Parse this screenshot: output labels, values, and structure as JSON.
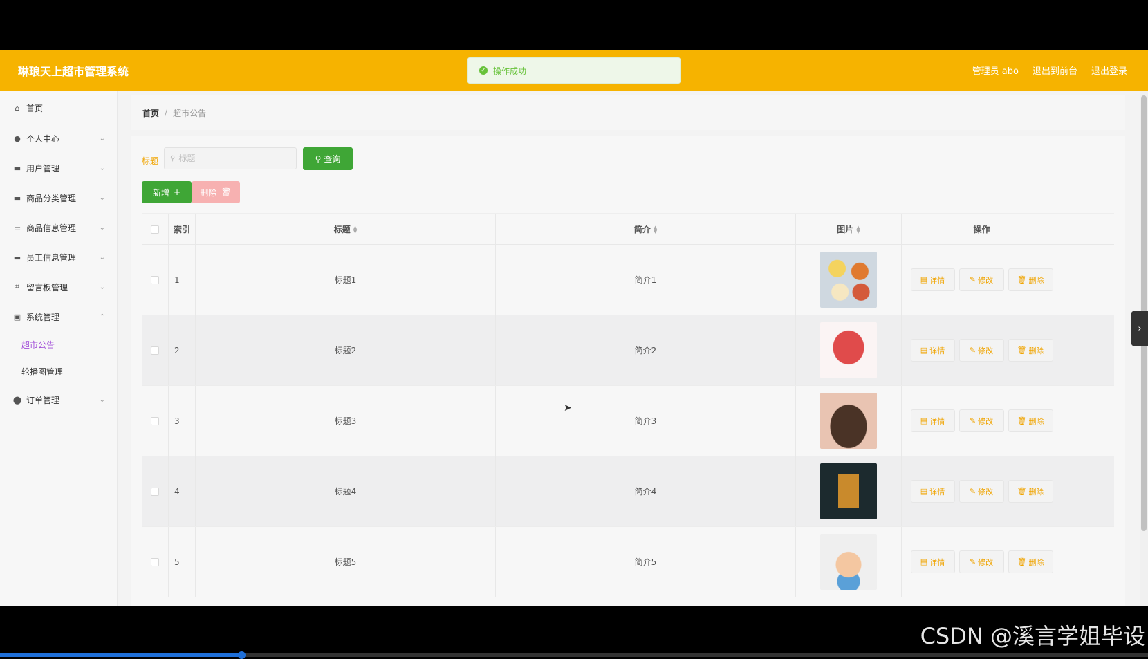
{
  "header": {
    "brand": "琳琅天上超市管理系统",
    "admin": "管理员 abo",
    "frontend_link": "退出到前台",
    "logout_link": "退出登录"
  },
  "toast": {
    "message": "操作成功"
  },
  "sidebar": {
    "items": [
      {
        "label": "首页",
        "icon": "home-icon"
      },
      {
        "label": "个人中心",
        "icon": "user-icon"
      },
      {
        "label": "用户管理",
        "icon": "briefcase-icon"
      },
      {
        "label": "商品分类管理",
        "icon": "monitor-icon"
      },
      {
        "label": "商品信息管理",
        "icon": "list-icon"
      },
      {
        "label": "员工信息管理",
        "icon": "monitor-icon"
      },
      {
        "label": "留言板管理",
        "icon": "crop-icon"
      },
      {
        "label": "系统管理",
        "icon": "clipboard-icon"
      },
      {
        "label": "订单管理",
        "icon": "location-icon"
      }
    ],
    "sub_items": [
      {
        "label": "超市公告",
        "active": true
      },
      {
        "label": "轮播图管理",
        "active": false
      }
    ]
  },
  "breadcrumb": {
    "home": "首页",
    "separator": "/",
    "current": "超市公告"
  },
  "search": {
    "label": "标题",
    "placeholder": "标题",
    "query_button": "查询"
  },
  "actions": {
    "add": "新增",
    "delete": "删除"
  },
  "table": {
    "columns": [
      "索引",
      "标题",
      "简介",
      "图片",
      "操作"
    ],
    "rows": [
      {
        "index": "1",
        "title": "标题1",
        "intro": "简介1",
        "image": "food-bowls"
      },
      {
        "index": "2",
        "title": "标题2",
        "intro": "简介2",
        "image": "shopping-cart"
      },
      {
        "index": "3",
        "title": "标题3",
        "intro": "简介3",
        "image": "handbag"
      },
      {
        "index": "4",
        "title": "标题4",
        "intro": "简介4",
        "image": "drink"
      },
      {
        "index": "5",
        "title": "标题5",
        "intro": "简介5",
        "image": "cartoon"
      }
    ],
    "row_actions": {
      "detail": "详情",
      "edit": "修改",
      "remove": "删除"
    }
  },
  "colors": {
    "header": "#f6b300",
    "primary_green": "#3fa636",
    "accent": "#f0a400",
    "active_sub": "#a24ed8"
  },
  "watermark": "CSDN @溪言学姐毕设",
  "video_progress": 0.21
}
